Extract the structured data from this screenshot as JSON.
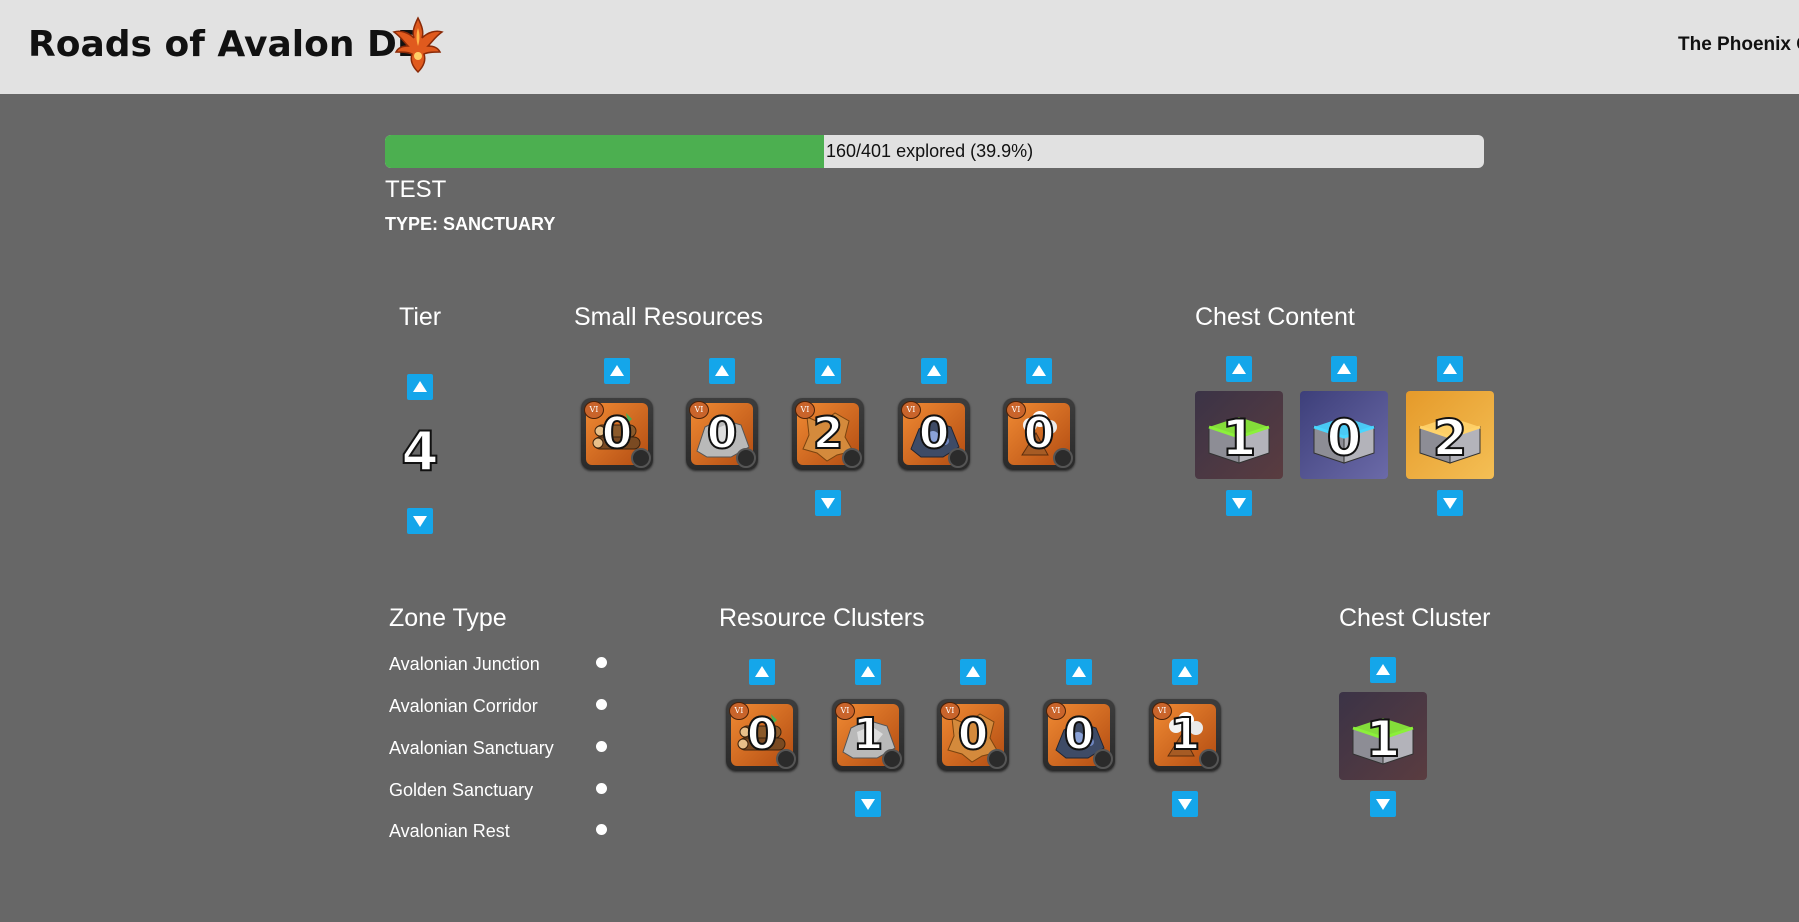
{
  "header": {
    "title": "Roads of Avalon DB",
    "right_text": "The Phoenix C"
  },
  "progress": {
    "text": "160/401 explored (39.9%)",
    "explored": 160,
    "total": 401,
    "fraction": 0.399,
    "fill_color": "#4caf50"
  },
  "zone": {
    "name": "TEST",
    "type_line": "TYPE: SANCTUARY"
  },
  "tier": {
    "title": "Tier",
    "value": "4"
  },
  "small_resources": {
    "title": "Small Resources",
    "items": [
      {
        "icon": "wood-resource-icon",
        "badge": "VI",
        "count": "0"
      },
      {
        "icon": "stone-resource-icon",
        "badge": "VI",
        "count": "0"
      },
      {
        "icon": "hide-resource-icon",
        "badge": "VI",
        "count": "2"
      },
      {
        "icon": "ore-resource-icon",
        "badge": "VI",
        "count": "0"
      },
      {
        "icon": "fiber-resource-icon",
        "badge": "VI",
        "count": "0"
      }
    ]
  },
  "chest_content": {
    "title": "Chest Content",
    "items": [
      {
        "icon": "green-chest-icon",
        "count": "1"
      },
      {
        "icon": "blue-chest-icon",
        "count": "0"
      },
      {
        "icon": "gold-chest-icon",
        "count": "2"
      }
    ]
  },
  "zone_type": {
    "title": "Zone Type",
    "options": [
      "Avalonian Junction",
      "Avalonian Corridor",
      "Avalonian Sanctuary",
      "Golden Sanctuary",
      "Avalonian Rest"
    ]
  },
  "resource_clusters": {
    "title": "Resource Clusters",
    "items": [
      {
        "icon": "wood-resource-icon",
        "badge": "VI",
        "count": "0"
      },
      {
        "icon": "stone-resource-icon",
        "badge": "VI",
        "count": "1"
      },
      {
        "icon": "hide-resource-icon",
        "badge": "VI",
        "count": "0"
      },
      {
        "icon": "ore-resource-icon",
        "badge": "VI",
        "count": "0"
      },
      {
        "icon": "fiber-resource-icon",
        "badge": "VI",
        "count": "1"
      }
    ]
  },
  "chest_cluster": {
    "title": "Chest Cluster",
    "items": [
      {
        "icon": "green-chest-icon",
        "count": "1"
      }
    ]
  },
  "colors": {
    "button": "#14a6ea",
    "background": "#676767",
    "header": "#e2e2e2"
  }
}
